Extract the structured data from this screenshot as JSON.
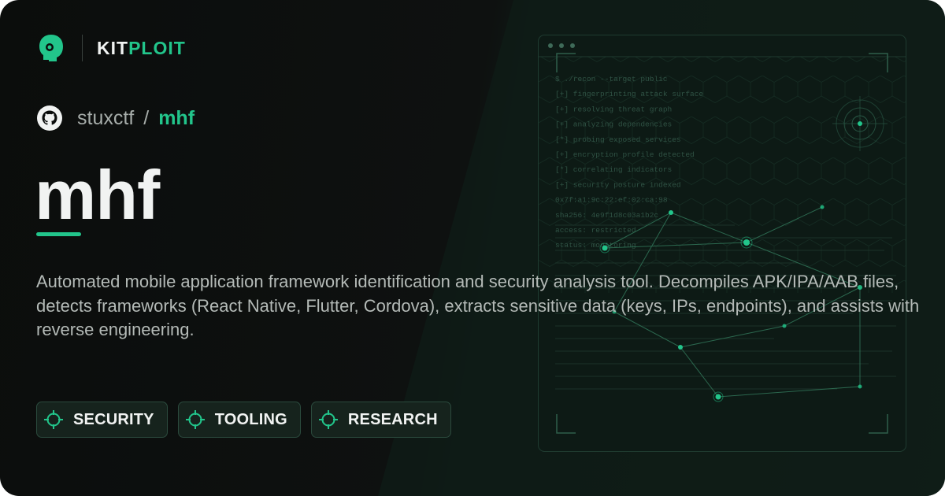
{
  "brand": {
    "kit": "KIT",
    "ploit": "PLOIT",
    "logo_icon": "kitploit-head-icon"
  },
  "repo": {
    "owner": "stuxctf",
    "separator": "/",
    "name": "mhf",
    "icon": "github-icon"
  },
  "title": "mhf",
  "description": "Automated mobile application framework identification and security analysis tool. Decompiles APK/IPA/AAB files, detects frameworks (React Native, Flutter, Cordova), extracts sensitive data (keys, IPs, endpoints), and assists with reverse engineering.",
  "tags": [
    {
      "label": "SECURITY",
      "icon": "crosshair-icon"
    },
    {
      "label": "TOOLING",
      "icon": "crosshair-icon"
    },
    {
      "label": "RESEARCH",
      "icon": "crosshair-icon"
    }
  ],
  "terminal": {
    "lines": [
      "$ ./recon --target public",
      "[+] fingerprinting attack surface",
      "[+] resolving threat graph",
      "[+] analyzing dependencies",
      "[*] probing exposed services",
      "[+] encryption profile detected",
      "[*] correlating indicators",
      "[+] security posture indexed",
      "0x7f:a1:9c:22:ef:02:ca:98",
      "sha256: 4e9f1d8c03a1b2c",
      "access: restricted",
      "status: monitoring"
    ]
  },
  "colors": {
    "accent": "#22c58b",
    "background": "#0b0d0c",
    "text": "#f1f3f2",
    "muted": "#b4bab7",
    "tag_border": "#2b4a3d"
  }
}
